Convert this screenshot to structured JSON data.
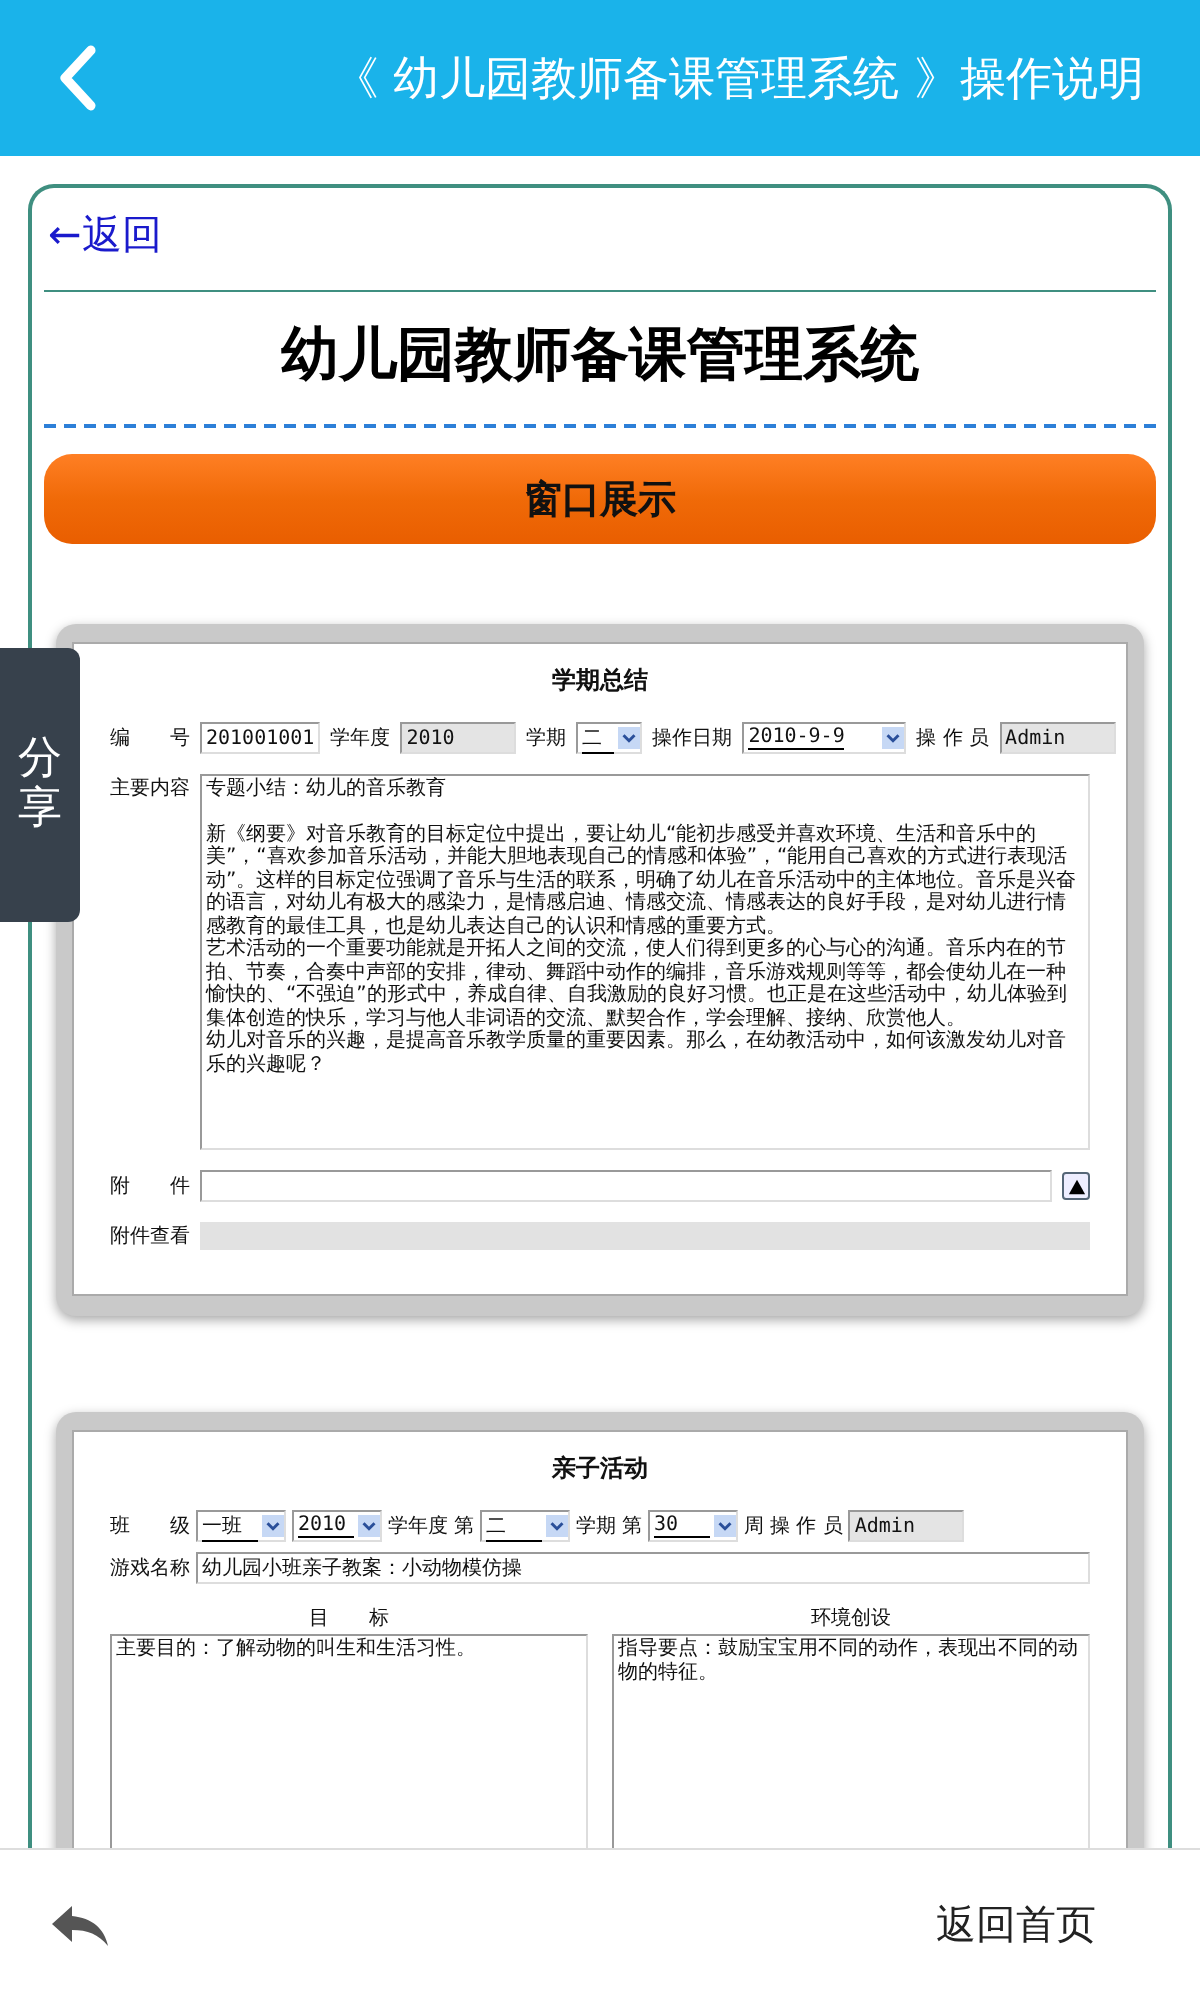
{
  "header": {
    "title": "《 幼儿园教师备课管理系统 》操作说明"
  },
  "back_link": "←返回",
  "page_title": "幼儿园教师备课管理系统",
  "section_button": "窗口展示",
  "share_tab": "分享",
  "form_1": {
    "title": "学期总结",
    "row": [
      {
        "kind": "label",
        "text": "编　　号"
      },
      {
        "kind": "input",
        "value": "201001001"
      },
      {
        "kind": "label",
        "text": "学年度"
      },
      {
        "kind": "readonly",
        "value": "2010"
      },
      {
        "kind": "label",
        "text": "学期"
      },
      {
        "kind": "select",
        "value": "二"
      },
      {
        "kind": "label",
        "text": "操作日期"
      },
      {
        "kind": "date",
        "value": "2010-9-9"
      },
      {
        "kind": "label",
        "text": "操 作 员"
      },
      {
        "kind": "readonly",
        "value": "Admin"
      }
    ],
    "content_label": "主要内容",
    "content_heading": "专题小结：幼儿的音乐教育",
    "content": [
      "新《纲要》对音乐教育的目标定位中提出，要让幼儿“能初步感受并喜欢环境、生活和音乐中的美”，“喜欢参加音乐活动，并能大胆地表现自己的情感和体验”，“能用自己喜欢的方式进行表现活动”。这样的目标定位强调了音乐与生活的联系，明确了幼儿在音乐活动中的主体地位。音乐是兴奋的语言，对幼儿有极大的感染力，是情感启迪、情感交流、情感表达的良好手段，是对幼儿进行情感教育的最佳工具，也是幼儿表达自己的认识和情感的重要方式。",
      "艺术活动的一个重要功能就是开拓人之间的交流，使人们得到更多的心与心的沟通。音乐内在的节拍、节奏，合奏中声部的安排，律动、舞蹈中动作的编排，音乐游戏规则等等，都会使幼儿在一种愉快的、“不强迫”的形式中，养成自律、自我激励的良好习惯。也正是在这些活动中，幼儿体验到集体创造的快乐，学习与他人非词语的交流、默契合作，学会理解、接纳、欣赏他人。",
      "幼儿对音乐的兴趣，是提高音乐教学质量的重要因素。那么，在幼教活动中，如何该激发幼儿对音乐的兴趣呢？"
    ],
    "attachment_label": "附　　件",
    "attachment_view_label": "附件查看"
  },
  "form_2": {
    "title": "亲子活动",
    "row": [
      {
        "kind": "label",
        "text": "班　　级"
      },
      {
        "kind": "select",
        "value": "一班"
      },
      {
        "kind": "select",
        "value": "2010"
      },
      {
        "kind": "label",
        "text": "学年度"
      },
      {
        "kind": "label",
        "text": "第"
      },
      {
        "kind": "select",
        "value": "二"
      },
      {
        "kind": "label",
        "text": "学期"
      },
      {
        "kind": "label",
        "text": "第"
      },
      {
        "kind": "select",
        "value": "30"
      },
      {
        "kind": "label",
        "text": "周"
      },
      {
        "kind": "label",
        "text": "操 作 员"
      },
      {
        "kind": "readonly",
        "value": "Admin"
      }
    ],
    "name_label": "游戏名称",
    "name_value": "幼儿园小班亲子教案：小动物模仿操",
    "columns": [
      {
        "heading": "目　　标",
        "text": "主要目的：了解动物的叫生和生活习性。"
      },
      {
        "heading": "环境创设",
        "text": "指导要点：鼓励宝宝用不同的动作，表现出不同的动物的特征。"
      }
    ]
  },
  "bottom_bar": {
    "home_link": "返回首页"
  }
}
